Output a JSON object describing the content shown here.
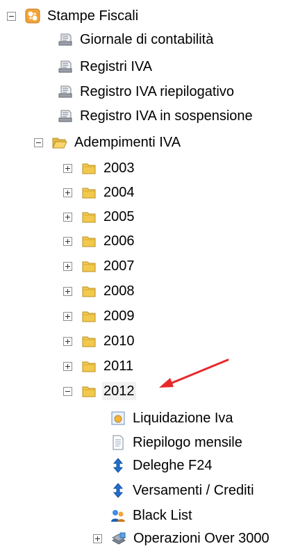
{
  "tree": {
    "root_label": "Stampe Fiscali",
    "reports": [
      "Giornale di contabilità",
      "Registri IVA",
      "Registro IVA riepilogativo",
      "Registro IVA in sospensione"
    ],
    "folder_label": "Adempimenti IVA",
    "years": [
      "2003",
      "2004",
      "2005",
      "2006",
      "2007",
      "2008",
      "2009",
      "2010",
      "2011"
    ],
    "selected_year": "2012",
    "children_2012": [
      {
        "label": "Liquidazione Iva",
        "icon": "liquidation-icon"
      },
      {
        "label": "Riepilogo mensile",
        "icon": "document-icon"
      },
      {
        "label": "Deleghe F24",
        "icon": "up-down-arrow-icon"
      },
      {
        "label": "Versamenti / Crediti",
        "icon": "up-down-arrow-icon"
      },
      {
        "label": "Black List",
        "icon": "users-icon"
      }
    ],
    "last_label": "Operazioni Over 3000"
  },
  "colors": {
    "folder": "#f2c94c",
    "folder_edge": "#b9902a",
    "arrow": "#e8282b",
    "blue_arrow": "#1f6fd1",
    "selected_bg": "#f0f0f0"
  }
}
